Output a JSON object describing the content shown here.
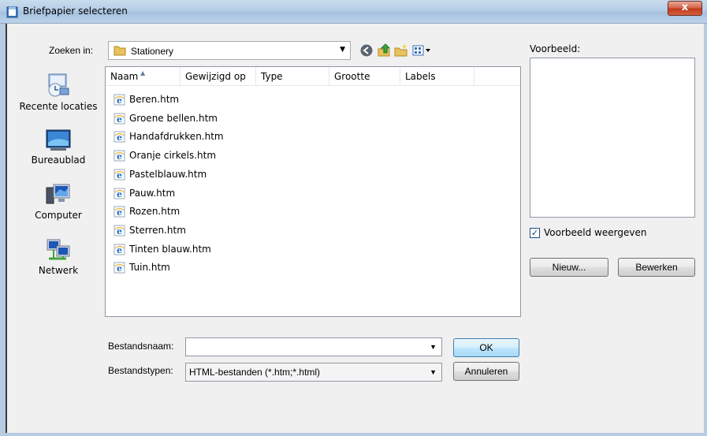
{
  "window": {
    "title": "Briefpapier selecteren",
    "close_label": "x"
  },
  "lookin": {
    "label": "Zoeken in:",
    "value": "Stationery"
  },
  "toolbar_icons": [
    "back-icon",
    "up-folder-icon",
    "new-folder-icon",
    "view-menu-icon"
  ],
  "places": [
    {
      "label": "Recente locaties",
      "icon": "recent-places-icon"
    },
    {
      "label": "Bureaublad",
      "icon": "desktop-icon"
    },
    {
      "label": "Computer",
      "icon": "computer-icon"
    },
    {
      "label": "Netwerk",
      "icon": "network-icon"
    }
  ],
  "columns": [
    "Naam",
    "Gewijzigd op",
    "Type",
    "Grootte",
    "Labels"
  ],
  "files": [
    "Beren.htm",
    "Groene bellen.htm",
    "Handafdrukken.htm",
    "Oranje cirkels.htm",
    "Pastelblauw.htm",
    "Pauw.htm",
    "Rozen.htm",
    "Sterren.htm",
    "Tinten blauw.htm",
    "Tuin.htm"
  ],
  "filename": {
    "label": "Bestandsnaam:",
    "value": ""
  },
  "filetype": {
    "label": "Bestandstypen:",
    "value": "HTML-bestanden (*.htm;*.html)"
  },
  "buttons": {
    "ok": "OK",
    "cancel": "Annuleren",
    "new": "Nieuw...",
    "edit": "Bewerken"
  },
  "preview": {
    "label": "Voorbeeld:",
    "checkbox_label": "Voorbeeld weergeven",
    "checked": true
  }
}
